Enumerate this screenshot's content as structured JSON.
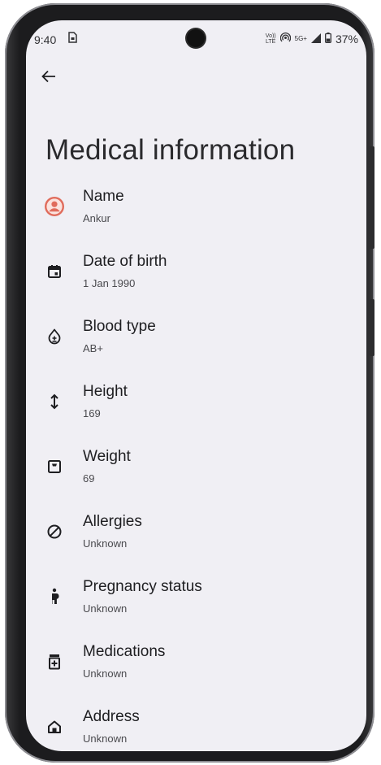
{
  "status_bar": {
    "time": "9:40",
    "volte_top": "Vo))",
    "volte_bottom": "LTE",
    "network": "5G+",
    "battery": "37%"
  },
  "header": {
    "back_icon": "arrow-back-icon",
    "title": "Medical information"
  },
  "items": [
    {
      "icon": "account-circle-icon",
      "label": "Name",
      "value": "Ankur"
    },
    {
      "icon": "calendar-icon",
      "label": "Date of birth",
      "value": "1 Jan 1990"
    },
    {
      "icon": "blood-drop-icon",
      "label": "Blood type",
      "value": "AB+"
    },
    {
      "icon": "height-icon",
      "label": "Height",
      "value": "169"
    },
    {
      "icon": "scale-icon",
      "label": "Weight",
      "value": "69"
    },
    {
      "icon": "block-icon",
      "label": "Allergies",
      "value": "Unknown"
    },
    {
      "icon": "pregnant-icon",
      "label": "Pregnancy status",
      "value": "Unknown"
    },
    {
      "icon": "medication-icon",
      "label": "Medications",
      "value": "Unknown"
    },
    {
      "icon": "home-icon",
      "label": "Address",
      "value": "Unknown"
    }
  ],
  "colors": {
    "accent": "#e06c5c",
    "background": "#f0eff4",
    "text": "#1e1e21"
  }
}
